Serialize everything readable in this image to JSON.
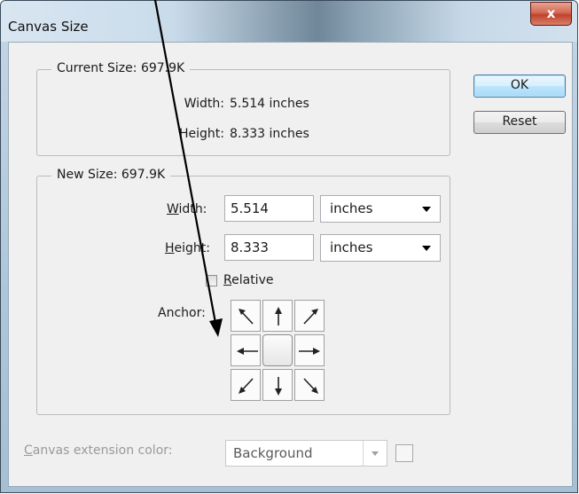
{
  "window": {
    "title": "Canvas Size",
    "close_glyph": "x"
  },
  "current_size": {
    "legend": "Current Size: 697.9K",
    "width_label": "Width:",
    "width_value": "5.514 inches",
    "height_label": "Height:",
    "height_value": "8.333 inches"
  },
  "new_size": {
    "legend": "New Size: 697.9K",
    "width_label_accel": "W",
    "width_label_rest": "idth:",
    "width_value": "5.514",
    "width_unit": "inches",
    "height_label_accel": "H",
    "height_label_rest": "eight:",
    "height_value": "8.333",
    "height_unit": "inches",
    "relative_label_accel": "R",
    "relative_label_rest": "elative",
    "relative_checked": false,
    "anchor_label": "Anchor:",
    "anchor_selected": "center"
  },
  "buttons": {
    "ok": "OK",
    "reset": "Reset"
  },
  "extension": {
    "label_accel": "C",
    "label_rest": "anvas extension color:",
    "value": "Background"
  },
  "icons": {
    "anchor_arrows": [
      "arrow-up-left-icon",
      "arrow-up-icon",
      "arrow-up-right-icon",
      "arrow-left-icon",
      "anchor-center",
      "arrow-right-icon",
      "arrow-down-left-icon",
      "arrow-down-icon",
      "arrow-down-right-icon"
    ],
    "annotation": "annotation-arrow-icon"
  },
  "colors": {
    "titlebar": "#c9dbea",
    "close_button": "#c0422b",
    "dialog_bg": "#f0f0f0",
    "default_button": "#bee6fd"
  }
}
